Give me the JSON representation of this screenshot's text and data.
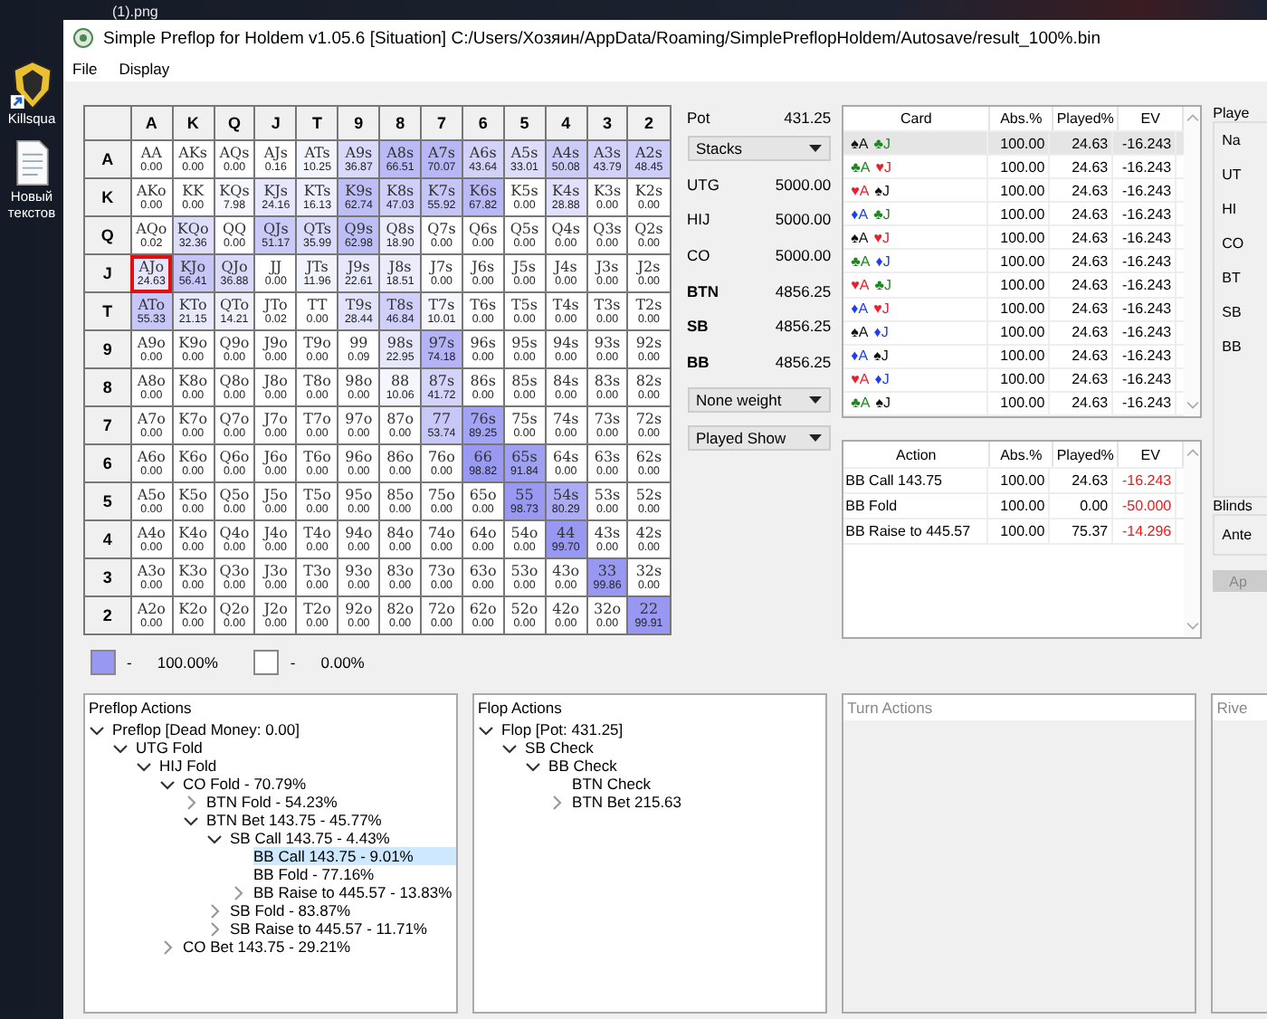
{
  "desktop": {
    "file_label": "(1).png",
    "icons": [
      {
        "kind": "knight",
        "label": "Killsqua"
      },
      {
        "kind": "document",
        "label": "Новый текстов"
      }
    ]
  },
  "window": {
    "title": "Simple Preflop for Holdem v1.05.6 [Situation] C:/Users/Хозяин/AppData/Roaming/SimplePreflopHoldem/Autosave/result_100%.bin",
    "menu": [
      "File",
      "Display"
    ]
  },
  "grid": {
    "columns": [
      "A",
      "K",
      "Q",
      "J",
      "T",
      "9",
      "8",
      "7",
      "6",
      "5",
      "4",
      "3",
      "2"
    ],
    "rows": [
      {
        "label": "A",
        "cells": [
          {
            "hand": "AA",
            "value": "0.00",
            "selected": false
          },
          {
            "hand": "AKs",
            "value": "0.00",
            "selected": false
          },
          {
            "hand": "AQs",
            "value": "0.00",
            "selected": false
          },
          {
            "hand": "AJs",
            "value": "0.16",
            "selected": false
          },
          {
            "hand": "ATs",
            "value": "10.25",
            "selected": false
          },
          {
            "hand": "A9s",
            "value": "36.87",
            "selected": false
          },
          {
            "hand": "A8s",
            "value": "66.51",
            "selected": false
          },
          {
            "hand": "A7s",
            "value": "70.07",
            "selected": false
          },
          {
            "hand": "A6s",
            "value": "43.64",
            "selected": false
          },
          {
            "hand": "A5s",
            "value": "33.01",
            "selected": false
          },
          {
            "hand": "A4s",
            "value": "50.08",
            "selected": false
          },
          {
            "hand": "A3s",
            "value": "43.79",
            "selected": false
          },
          {
            "hand": "A2s",
            "value": "48.45",
            "selected": false
          }
        ]
      },
      {
        "label": "K",
        "cells": [
          {
            "hand": "AKo",
            "value": "0.00",
            "selected": false
          },
          {
            "hand": "KK",
            "value": "0.00",
            "selected": false
          },
          {
            "hand": "KQs",
            "value": "7.98",
            "selected": false
          },
          {
            "hand": "KJs",
            "value": "24.16",
            "selected": false
          },
          {
            "hand": "KTs",
            "value": "16.13",
            "selected": false
          },
          {
            "hand": "K9s",
            "value": "62.74",
            "selected": false
          },
          {
            "hand": "K8s",
            "value": "47.03",
            "selected": false
          },
          {
            "hand": "K7s",
            "value": "55.92",
            "selected": false
          },
          {
            "hand": "K6s",
            "value": "67.82",
            "selected": false
          },
          {
            "hand": "K5s",
            "value": "0.00",
            "selected": false
          },
          {
            "hand": "K4s",
            "value": "28.88",
            "selected": false
          },
          {
            "hand": "K3s",
            "value": "0.00",
            "selected": false
          },
          {
            "hand": "K2s",
            "value": "0.00",
            "selected": false
          }
        ]
      },
      {
        "label": "Q",
        "cells": [
          {
            "hand": "AQo",
            "value": "0.02",
            "selected": false
          },
          {
            "hand": "KQo",
            "value": "32.36",
            "selected": false
          },
          {
            "hand": "QQ",
            "value": "0.00",
            "selected": false
          },
          {
            "hand": "QJs",
            "value": "51.17",
            "selected": false
          },
          {
            "hand": "QTs",
            "value": "35.99",
            "selected": false
          },
          {
            "hand": "Q9s",
            "value": "62.98",
            "selected": false
          },
          {
            "hand": "Q8s",
            "value": "18.90",
            "selected": false
          },
          {
            "hand": "Q7s",
            "value": "0.00",
            "selected": false
          },
          {
            "hand": "Q6s",
            "value": "0.00",
            "selected": false
          },
          {
            "hand": "Q5s",
            "value": "0.00",
            "selected": false
          },
          {
            "hand": "Q4s",
            "value": "0.00",
            "selected": false
          },
          {
            "hand": "Q3s",
            "value": "0.00",
            "selected": false
          },
          {
            "hand": "Q2s",
            "value": "0.00",
            "selected": false
          }
        ]
      },
      {
        "label": "J",
        "cells": [
          {
            "hand": "AJo",
            "value": "24.63",
            "selected": true
          },
          {
            "hand": "KJo",
            "value": "56.41",
            "selected": false
          },
          {
            "hand": "QJo",
            "value": "36.88",
            "selected": false
          },
          {
            "hand": "JJ",
            "value": "0.00",
            "selected": false
          },
          {
            "hand": "JTs",
            "value": "11.96",
            "selected": false
          },
          {
            "hand": "J9s",
            "value": "22.61",
            "selected": false
          },
          {
            "hand": "J8s",
            "value": "18.51",
            "selected": false
          },
          {
            "hand": "J7s",
            "value": "0.00",
            "selected": false
          },
          {
            "hand": "J6s",
            "value": "0.00",
            "selected": false
          },
          {
            "hand": "J5s",
            "value": "0.00",
            "selected": false
          },
          {
            "hand": "J4s",
            "value": "0.00",
            "selected": false
          },
          {
            "hand": "J3s",
            "value": "0.00",
            "selected": false
          },
          {
            "hand": "J2s",
            "value": "0.00",
            "selected": false
          }
        ]
      },
      {
        "label": "T",
        "cells": [
          {
            "hand": "ATo",
            "value": "55.33",
            "selected": false
          },
          {
            "hand": "KTo",
            "value": "21.15",
            "selected": false
          },
          {
            "hand": "QTo",
            "value": "14.21",
            "selected": false
          },
          {
            "hand": "JTo",
            "value": "0.02",
            "selected": false
          },
          {
            "hand": "TT",
            "value": "0.00",
            "selected": false
          },
          {
            "hand": "T9s",
            "value": "28.44",
            "selected": false
          },
          {
            "hand": "T8s",
            "value": "46.84",
            "selected": false
          },
          {
            "hand": "T7s",
            "value": "10.01",
            "selected": false
          },
          {
            "hand": "T6s",
            "value": "0.00",
            "selected": false
          },
          {
            "hand": "T5s",
            "value": "0.00",
            "selected": false
          },
          {
            "hand": "T4s",
            "value": "0.00",
            "selected": false
          },
          {
            "hand": "T3s",
            "value": "0.00",
            "selected": false
          },
          {
            "hand": "T2s",
            "value": "0.00",
            "selected": false
          }
        ]
      },
      {
        "label": "9",
        "cells": [
          {
            "hand": "A9o",
            "value": "0.00",
            "selected": false
          },
          {
            "hand": "K9o",
            "value": "0.00",
            "selected": false
          },
          {
            "hand": "Q9o",
            "value": "0.00",
            "selected": false
          },
          {
            "hand": "J9o",
            "value": "0.00",
            "selected": false
          },
          {
            "hand": "T9o",
            "value": "0.00",
            "selected": false
          },
          {
            "hand": "99",
            "value": "0.09",
            "selected": false
          },
          {
            "hand": "98s",
            "value": "22.95",
            "selected": false
          },
          {
            "hand": "97s",
            "value": "74.18",
            "selected": false
          },
          {
            "hand": "96s",
            "value": "0.00",
            "selected": false
          },
          {
            "hand": "95s",
            "value": "0.00",
            "selected": false
          },
          {
            "hand": "94s",
            "value": "0.00",
            "selected": false
          },
          {
            "hand": "93s",
            "value": "0.00",
            "selected": false
          },
          {
            "hand": "92s",
            "value": "0.00",
            "selected": false
          }
        ]
      },
      {
        "label": "8",
        "cells": [
          {
            "hand": "A8o",
            "value": "0.00",
            "selected": false
          },
          {
            "hand": "K8o",
            "value": "0.00",
            "selected": false
          },
          {
            "hand": "Q8o",
            "value": "0.00",
            "selected": false
          },
          {
            "hand": "J8o",
            "value": "0.00",
            "selected": false
          },
          {
            "hand": "T8o",
            "value": "0.00",
            "selected": false
          },
          {
            "hand": "98o",
            "value": "0.00",
            "selected": false
          },
          {
            "hand": "88",
            "value": "10.06",
            "selected": false
          },
          {
            "hand": "87s",
            "value": "41.72",
            "selected": false
          },
          {
            "hand": "86s",
            "value": "0.00",
            "selected": false
          },
          {
            "hand": "85s",
            "value": "0.00",
            "selected": false
          },
          {
            "hand": "84s",
            "value": "0.00",
            "selected": false
          },
          {
            "hand": "83s",
            "value": "0.00",
            "selected": false
          },
          {
            "hand": "82s",
            "value": "0.00",
            "selected": false
          }
        ]
      },
      {
        "label": "7",
        "cells": [
          {
            "hand": "A7o",
            "value": "0.00",
            "selected": false
          },
          {
            "hand": "K7o",
            "value": "0.00",
            "selected": false
          },
          {
            "hand": "Q7o",
            "value": "0.00",
            "selected": false
          },
          {
            "hand": "J7o",
            "value": "0.00",
            "selected": false
          },
          {
            "hand": "T7o",
            "value": "0.00",
            "selected": false
          },
          {
            "hand": "97o",
            "value": "0.00",
            "selected": false
          },
          {
            "hand": "87o",
            "value": "0.00",
            "selected": false
          },
          {
            "hand": "77",
            "value": "53.74",
            "selected": false
          },
          {
            "hand": "76s",
            "value": "89.25",
            "selected": false
          },
          {
            "hand": "75s",
            "value": "0.00",
            "selected": false
          },
          {
            "hand": "74s",
            "value": "0.00",
            "selected": false
          },
          {
            "hand": "73s",
            "value": "0.00",
            "selected": false
          },
          {
            "hand": "72s",
            "value": "0.00",
            "selected": false
          }
        ]
      },
      {
        "label": "6",
        "cells": [
          {
            "hand": "A6o",
            "value": "0.00",
            "selected": false
          },
          {
            "hand": "K6o",
            "value": "0.00",
            "selected": false
          },
          {
            "hand": "Q6o",
            "value": "0.00",
            "selected": false
          },
          {
            "hand": "J6o",
            "value": "0.00",
            "selected": false
          },
          {
            "hand": "T6o",
            "value": "0.00",
            "selected": false
          },
          {
            "hand": "96o",
            "value": "0.00",
            "selected": false
          },
          {
            "hand": "86o",
            "value": "0.00",
            "selected": false
          },
          {
            "hand": "76o",
            "value": "0.00",
            "selected": false
          },
          {
            "hand": "66",
            "value": "98.82",
            "selected": false
          },
          {
            "hand": "65s",
            "value": "91.84",
            "selected": false
          },
          {
            "hand": "64s",
            "value": "0.00",
            "selected": false
          },
          {
            "hand": "63s",
            "value": "0.00",
            "selected": false
          },
          {
            "hand": "62s",
            "value": "0.00",
            "selected": false
          }
        ]
      },
      {
        "label": "5",
        "cells": [
          {
            "hand": "A5o",
            "value": "0.00",
            "selected": false
          },
          {
            "hand": "K5o",
            "value": "0.00",
            "selected": false
          },
          {
            "hand": "Q5o",
            "value": "0.00",
            "selected": false
          },
          {
            "hand": "J5o",
            "value": "0.00",
            "selected": false
          },
          {
            "hand": "T5o",
            "value": "0.00",
            "selected": false
          },
          {
            "hand": "95o",
            "value": "0.00",
            "selected": false
          },
          {
            "hand": "85o",
            "value": "0.00",
            "selected": false
          },
          {
            "hand": "75o",
            "value": "0.00",
            "selected": false
          },
          {
            "hand": "65o",
            "value": "0.00",
            "selected": false
          },
          {
            "hand": "55",
            "value": "98.73",
            "selected": false
          },
          {
            "hand": "54s",
            "value": "80.29",
            "selected": false
          },
          {
            "hand": "53s",
            "value": "0.00",
            "selected": false
          },
          {
            "hand": "52s",
            "value": "0.00",
            "selected": false
          }
        ]
      },
      {
        "label": "4",
        "cells": [
          {
            "hand": "A4o",
            "value": "0.00",
            "selected": false
          },
          {
            "hand": "K4o",
            "value": "0.00",
            "selected": false
          },
          {
            "hand": "Q4o",
            "value": "0.00",
            "selected": false
          },
          {
            "hand": "J4o",
            "value": "0.00",
            "selected": false
          },
          {
            "hand": "T4o",
            "value": "0.00",
            "selected": false
          },
          {
            "hand": "94o",
            "value": "0.00",
            "selected": false
          },
          {
            "hand": "84o",
            "value": "0.00",
            "selected": false
          },
          {
            "hand": "74o",
            "value": "0.00",
            "selected": false
          },
          {
            "hand": "64o",
            "value": "0.00",
            "selected": false
          },
          {
            "hand": "54o",
            "value": "0.00",
            "selected": false
          },
          {
            "hand": "44",
            "value": "99.70",
            "selected": false
          },
          {
            "hand": "43s",
            "value": "0.00",
            "selected": false
          },
          {
            "hand": "42s",
            "value": "0.00",
            "selected": false
          }
        ]
      },
      {
        "label": "3",
        "cells": [
          {
            "hand": "A3o",
            "value": "0.00",
            "selected": false
          },
          {
            "hand": "K3o",
            "value": "0.00",
            "selected": false
          },
          {
            "hand": "Q3o",
            "value": "0.00",
            "selected": false
          },
          {
            "hand": "J3o",
            "value": "0.00",
            "selected": false
          },
          {
            "hand": "T3o",
            "value": "0.00",
            "selected": false
          },
          {
            "hand": "93o",
            "value": "0.00",
            "selected": false
          },
          {
            "hand": "83o",
            "value": "0.00",
            "selected": false
          },
          {
            "hand": "73o",
            "value": "0.00",
            "selected": false
          },
          {
            "hand": "63o",
            "value": "0.00",
            "selected": false
          },
          {
            "hand": "53o",
            "value": "0.00",
            "selected": false
          },
          {
            "hand": "43o",
            "value": "0.00",
            "selected": false
          },
          {
            "hand": "33",
            "value": "99.86",
            "selected": false
          },
          {
            "hand": "32s",
            "value": "0.00",
            "selected": false
          }
        ]
      },
      {
        "label": "2",
        "cells": [
          {
            "hand": "A2o",
            "value": "0.00",
            "selected": false
          },
          {
            "hand": "K2o",
            "value": "0.00",
            "selected": false
          },
          {
            "hand": "Q2o",
            "value": "0.00",
            "selected": false
          },
          {
            "hand": "J2o",
            "value": "0.00",
            "selected": false
          },
          {
            "hand": "T2o",
            "value": "0.00",
            "selected": false
          },
          {
            "hand": "92o",
            "value": "0.00",
            "selected": false
          },
          {
            "hand": "82o",
            "value": "0.00",
            "selected": false
          },
          {
            "hand": "72o",
            "value": "0.00",
            "selected": false
          },
          {
            "hand": "62o",
            "value": "0.00",
            "selected": false
          },
          {
            "hand": "52o",
            "value": "0.00",
            "selected": false
          },
          {
            "hand": "42o",
            "value": "0.00",
            "selected": false
          },
          {
            "hand": "32o",
            "value": "0.00",
            "selected": false
          },
          {
            "hand": "22",
            "value": "99.91",
            "selected": false
          }
        ]
      }
    ]
  },
  "legend": [
    {
      "color": "#9898f2",
      "dash": "-",
      "text": "100.00%"
    },
    {
      "color": "#ffffff",
      "dash": "-",
      "text": "0.00%"
    }
  ],
  "pot": {
    "label": "Pot",
    "value": "431.25"
  },
  "stacks_dropdown": "Stacks",
  "stacks": [
    {
      "position": "UTG",
      "value": "5000.00",
      "active": false
    },
    {
      "position": "HIJ",
      "value": "5000.00",
      "active": false
    },
    {
      "position": "CO",
      "value": "5000.00",
      "active": false
    },
    {
      "position": "BTN",
      "value": "4856.25",
      "active": true
    },
    {
      "position": "SB",
      "value": "4856.25",
      "active": true
    },
    {
      "position": "BB",
      "value": "4856.25",
      "active": true
    }
  ],
  "weight_dropdown": "None weight",
  "show_dropdown": "Played Show",
  "card_table": {
    "columns": [
      "Card",
      "Abs.%",
      "Played%",
      "EV"
    ],
    "rows": [
      {
        "cards": [
          {
            "color": "#111111",
            "text": "♠A"
          },
          {
            "color": "#1a8a1a",
            "text": "♣J"
          }
        ],
        "abs": "100.00",
        "played": "24.63",
        "ev": "-16.243",
        "selected": true
      },
      {
        "cards": [
          {
            "color": "#1a8a1a",
            "text": "♣A"
          },
          {
            "color": "#e8202a",
            "text": "♥J"
          }
        ],
        "abs": "100.00",
        "played": "24.63",
        "ev": "-16.243",
        "selected": false
      },
      {
        "cards": [
          {
            "color": "#e8202a",
            "text": "♥A"
          },
          {
            "color": "#111111",
            "text": "♠J"
          }
        ],
        "abs": "100.00",
        "played": "24.63",
        "ev": "-16.243",
        "selected": false
      },
      {
        "cards": [
          {
            "color": "#1e3ef0",
            "text": "♦A"
          },
          {
            "color": "#1a8a1a",
            "text": "♣J"
          }
        ],
        "abs": "100.00",
        "played": "24.63",
        "ev": "-16.243",
        "selected": false
      },
      {
        "cards": [
          {
            "color": "#111111",
            "text": "♠A"
          },
          {
            "color": "#e8202a",
            "text": "♥J"
          }
        ],
        "abs": "100.00",
        "played": "24.63",
        "ev": "-16.243",
        "selected": false
      },
      {
        "cards": [
          {
            "color": "#1a8a1a",
            "text": "♣A"
          },
          {
            "color": "#1e3ef0",
            "text": "♦J"
          }
        ],
        "abs": "100.00",
        "played": "24.63",
        "ev": "-16.243",
        "selected": false
      },
      {
        "cards": [
          {
            "color": "#e8202a",
            "text": "♥A"
          },
          {
            "color": "#1a8a1a",
            "text": "♣J"
          }
        ],
        "abs": "100.00",
        "played": "24.63",
        "ev": "-16.243",
        "selected": false
      },
      {
        "cards": [
          {
            "color": "#1e3ef0",
            "text": "♦A"
          },
          {
            "color": "#e8202a",
            "text": "♥J"
          }
        ],
        "abs": "100.00",
        "played": "24.63",
        "ev": "-16.243",
        "selected": false
      },
      {
        "cards": [
          {
            "color": "#111111",
            "text": "♠A"
          },
          {
            "color": "#1e3ef0",
            "text": "♦J"
          }
        ],
        "abs": "100.00",
        "played": "24.63",
        "ev": "-16.243",
        "selected": false
      },
      {
        "cards": [
          {
            "color": "#1e3ef0",
            "text": "♦A"
          },
          {
            "color": "#111111",
            "text": "♠J"
          }
        ],
        "abs": "100.00",
        "played": "24.63",
        "ev": "-16.243",
        "selected": false
      },
      {
        "cards": [
          {
            "color": "#e8202a",
            "text": "♥A"
          },
          {
            "color": "#1e3ef0",
            "text": "♦J"
          }
        ],
        "abs": "100.00",
        "played": "24.63",
        "ev": "-16.243",
        "selected": false
      },
      {
        "cards": [
          {
            "color": "#1a8a1a",
            "text": "♣A"
          },
          {
            "color": "#111111",
            "text": "♠J"
          }
        ],
        "abs": "100.00",
        "played": "24.63",
        "ev": "-16.243",
        "selected": false
      }
    ]
  },
  "action_table": {
    "columns": [
      "Action",
      "Abs.%",
      "Played%",
      "EV"
    ],
    "rows": [
      {
        "action": "BB Call 143.75",
        "abs": "100.00",
        "played": "24.63",
        "ev": "-16.243",
        "selected": false
      },
      {
        "action": "BB Fold",
        "abs": "100.00",
        "played": "0.00",
        "ev": "-50.000",
        "selected": false
      },
      {
        "action": "BB Raise to 445.57",
        "abs": "100.00",
        "played": "75.37",
        "ev": "-14.296",
        "selected": false
      }
    ]
  },
  "side_panel": {
    "group_title": "Playe",
    "labels": [
      "Na",
      "UT",
      "HI",
      "CO",
      "BT",
      "SB",
      "BB"
    ],
    "blinds_title": "Blinds",
    "blinds_labels": [
      "Ante"
    ],
    "apply_button": {
      "label": "Ap",
      "disabled": true
    }
  },
  "action_panels": [
    {
      "title": "Preflop Actions",
      "disabled": false,
      "tree": [
        {
          "label": "Preflop [Dead Money: 0.00]",
          "kind": "open",
          "selected": false,
          "children": [
            {
              "label": "UTG Fold",
              "kind": "open",
              "selected": false,
              "children": [
                {
                  "label": "HIJ Fold",
                  "kind": "open",
                  "selected": false,
                  "children": [
                    {
                      "label": "CO Fold - 70.79%",
                      "kind": "open",
                      "selected": false,
                      "children": [
                        {
                          "label": "BTN Fold - 54.23%",
                          "kind": "closed",
                          "selected": false
                        },
                        {
                          "label": "BTN Bet 143.75 - 45.77%",
                          "kind": "open",
                          "selected": false,
                          "children": [
                            {
                              "label": "SB Call 143.75 - 4.43%",
                              "kind": "open",
                              "selected": false,
                              "children": [
                                {
                                  "label": "BB Call 143.75 - 9.01%",
                                  "kind": "leaf",
                                  "selected": true
                                },
                                {
                                  "label": "BB Fold - 77.16%",
                                  "kind": "leaf",
                                  "selected": false
                                },
                                {
                                  "label": "BB Raise to 445.57 - 13.83%",
                                  "kind": "closed",
                                  "selected": false
                                }
                              ]
                            },
                            {
                              "label": "SB Fold - 83.87%",
                              "kind": "closed",
                              "selected": false
                            },
                            {
                              "label": "SB Raise to 445.57 - 11.71%",
                              "kind": "closed",
                              "selected": false
                            }
                          ]
                        }
                      ]
                    },
                    {
                      "label": "CO Bet 143.75 - 29.21%",
                      "kind": "closed",
                      "selected": false
                    }
                  ]
                }
              ]
            }
          ]
        }
      ]
    },
    {
      "title": "Flop Actions",
      "disabled": false,
      "tree": [
        {
          "label": "Flop [Pot: 431.25]",
          "kind": "open",
          "selected": false,
          "children": [
            {
              "label": "SB Check",
              "kind": "open",
              "selected": false,
              "children": [
                {
                  "label": "BB Check",
                  "kind": "open",
                  "selected": false,
                  "children": [
                    {
                      "label": "BTN Check",
                      "kind": "leaf",
                      "selected": false
                    },
                    {
                      "label": "BTN Bet 215.63",
                      "kind": "closed",
                      "selected": false
                    }
                  ]
                }
              ]
            }
          ]
        }
      ]
    },
    {
      "title": "Turn Actions",
      "disabled": true
    },
    {
      "title": "Rive",
      "disabled": true
    }
  ]
}
